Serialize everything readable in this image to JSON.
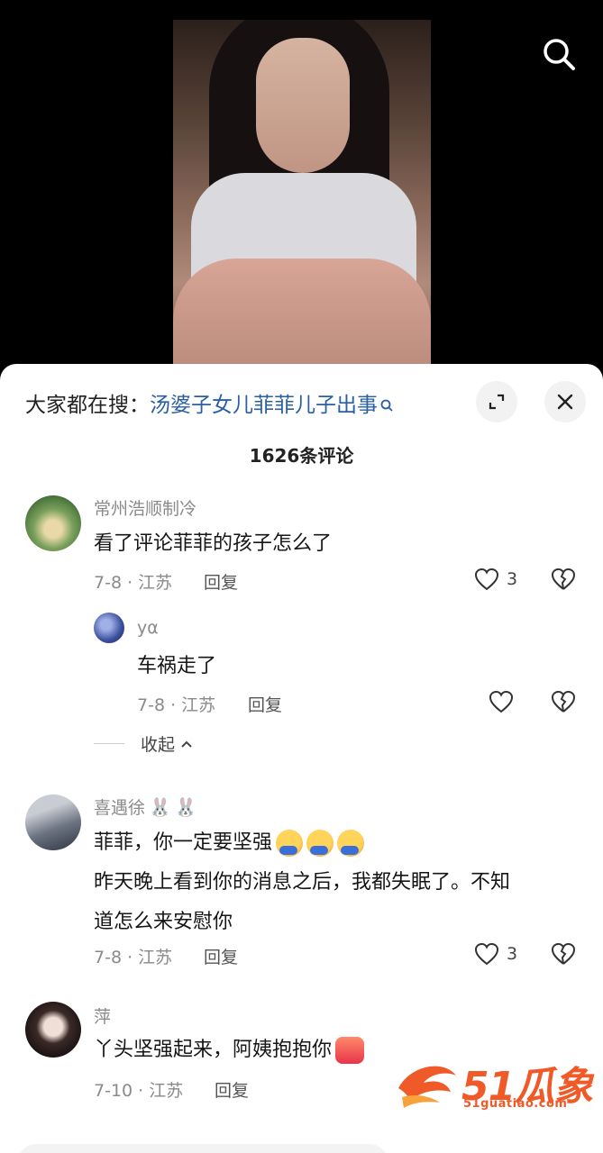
{
  "video": {
    "search_icon": "search-icon"
  },
  "panel": {
    "hot_search_prefix": "大家都在搜：",
    "hot_search_keyword": "汤婆子女儿菲菲儿子出事",
    "comment_count": "1626条评论",
    "expand_icon": "expand-icon",
    "close_icon": "close-icon"
  },
  "comments": [
    {
      "name": "常州浩顺制冷",
      "text": "看了评论菲菲的孩子怎么了",
      "meta": "7-8 · 江苏",
      "reply_label": "回复",
      "likes": "3",
      "replies": [
        {
          "name": "yα",
          "text": "车祸走了",
          "meta": "7-8 · 江苏",
          "reply_label": "回复"
        }
      ],
      "collapse_label": "收起"
    },
    {
      "name": "喜遇徐",
      "text_line1": "菲菲，你一定要坚强",
      "text_line2": "昨天晚上看到你的消息之后，我都失眠了。不知",
      "text_line3": "道怎么来安慰你",
      "meta": "7-8 · 江苏",
      "reply_label": "回复",
      "likes": "3"
    },
    {
      "name": "萍",
      "text": "丫头坚强起来，阿姨抱抱你",
      "meta": "7-10 · 江苏",
      "reply_label": "回复"
    }
  ],
  "watermark": {
    "brand": "51瓜象",
    "url": "51guatiao.com"
  },
  "input": {
    "placeholder": ""
  },
  "colors": {
    "keyword": "#2a5fa3",
    "watermark": "#f05a28"
  }
}
